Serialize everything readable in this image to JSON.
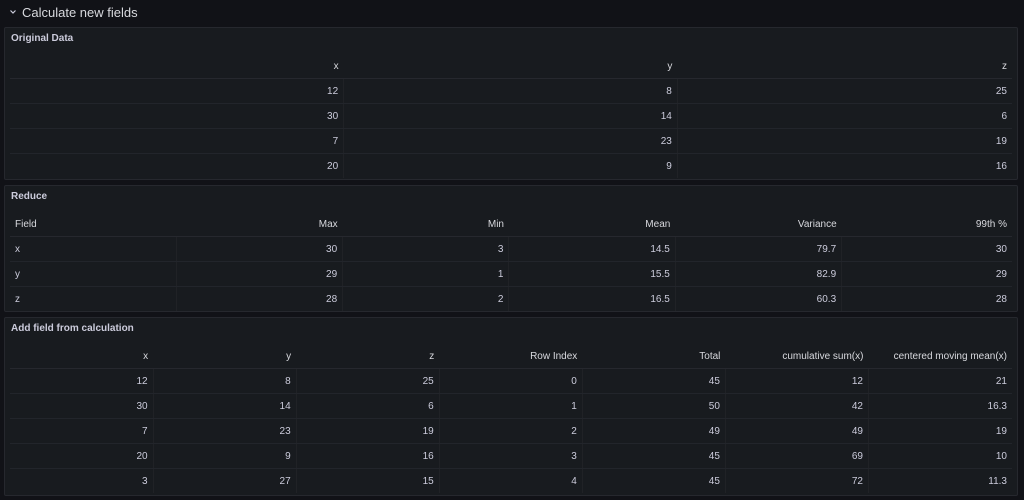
{
  "row": {
    "title": "Calculate new fields",
    "chevron_icon": "chevron-down-icon"
  },
  "original": {
    "title": "Original Data",
    "headers": [
      "x",
      "y",
      "z"
    ],
    "rows": [
      [
        "12",
        "8",
        "25"
      ],
      [
        "30",
        "14",
        "6"
      ],
      [
        "7",
        "23",
        "19"
      ],
      [
        "20",
        "9",
        "16"
      ]
    ]
  },
  "reduce": {
    "title": "Reduce",
    "headers": [
      "Field",
      "Max",
      "Min",
      "Mean",
      "Variance",
      "99th %"
    ],
    "rows": [
      [
        "x",
        "30",
        "3",
        "14.5",
        "79.7",
        "30"
      ],
      [
        "y",
        "29",
        "1",
        "15.5",
        "82.9",
        "29"
      ],
      [
        "z",
        "28",
        "2",
        "16.5",
        "60.3",
        "28"
      ]
    ]
  },
  "calc": {
    "title": "Add field from calculation",
    "headers": [
      "x",
      "y",
      "z",
      "Row Index",
      "Total",
      "cumulative sum(x)",
      "centered moving mean(x)"
    ],
    "rows": [
      [
        "12",
        "8",
        "25",
        "0",
        "45",
        "12",
        "21"
      ],
      [
        "30",
        "14",
        "6",
        "1",
        "50",
        "42",
        "16.3"
      ],
      [
        "7",
        "23",
        "19",
        "2",
        "49",
        "49",
        "19"
      ],
      [
        "20",
        "9",
        "16",
        "3",
        "45",
        "69",
        "10"
      ],
      [
        "3",
        "27",
        "15",
        "4",
        "45",
        "72",
        "11.3"
      ]
    ]
  }
}
